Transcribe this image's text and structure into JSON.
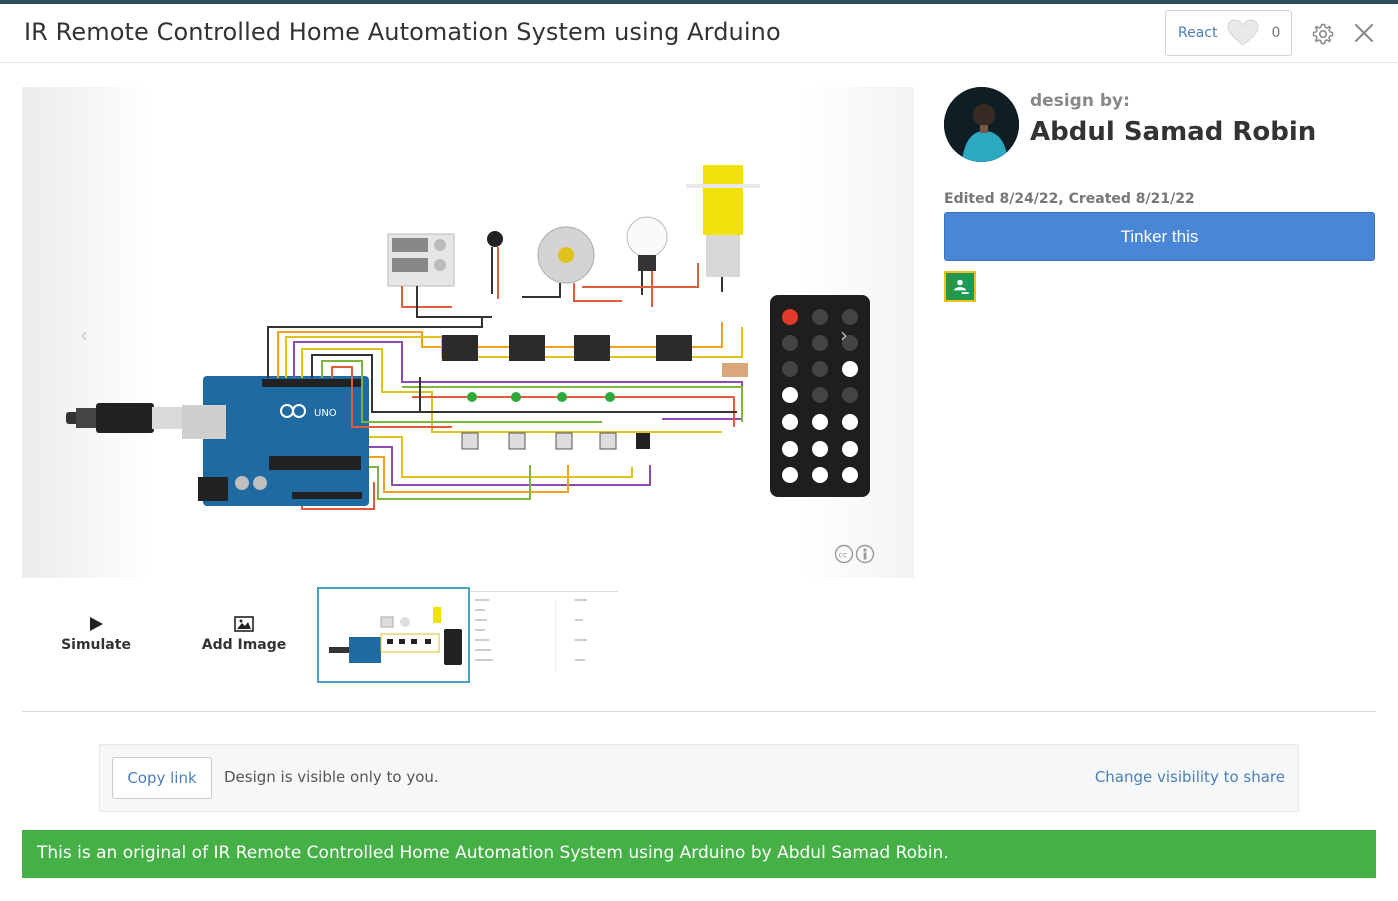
{
  "window": {
    "title": "IR Remote Controlled Home Automation System using Arduino"
  },
  "header": {
    "react_label": "React",
    "react_count": "0",
    "icons": [
      "heart-icon",
      "gear-icon",
      "close-icon"
    ]
  },
  "viewer": {
    "image_subject": "Arduino UNO circuit with relays, motors, bulb, power supply and IR remote",
    "icons": [
      "chevron-left-icon",
      "chevron-right-icon",
      "creative-commons-icon"
    ]
  },
  "toolbar": {
    "simulate_label": "Simulate",
    "add_image_label": "Add Image",
    "icons": [
      "play-icon",
      "image-icon"
    ]
  },
  "author": {
    "design_by": "design by:",
    "name": "Abdul Samad Robin",
    "dates": "Edited 8/24/22, Created 8/21/22"
  },
  "actions": {
    "tinker_label": "Tinker this",
    "icons": [
      "google-classroom-icon"
    ]
  },
  "share": {
    "copy_label": "Copy link",
    "visibility_text": "Design is visible only to you.",
    "change_visibility_label": "Change visibility to share"
  },
  "banner": {
    "text": "This is an original of IR Remote Controlled Home Automation System using Arduino by Abdul Samad Robin."
  },
  "colors": {
    "accent": "#4a86d6",
    "link": "#4a7fb8",
    "banner": "#44b046",
    "thumb_selected": "#4aa3c2"
  }
}
